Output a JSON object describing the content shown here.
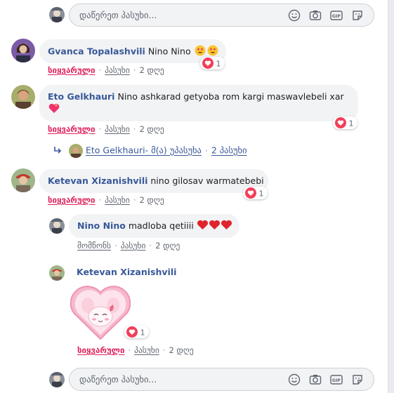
{
  "input_placeholder": "დაწერეთ პასუხი...",
  "actions": {
    "like": "სიყვარული",
    "like_plain": "მომწონს",
    "reply": "პასუხი",
    "time": "2 დღე"
  },
  "comments": [
    {
      "author": "Gvanca Topalashvili",
      "text": "Nino Nino",
      "reaction_count": "1"
    },
    {
      "author": "Eto Gelkhauri",
      "text": "Nino ashkarad getyoba rom kargi maswavlebeli xar",
      "reaction_count": "1",
      "reply_summary": {
        "author": "Eto Gelkhauri",
        "suffix": "- მ(ა) უპასუხა",
        "count": "2 პასუხი"
      }
    },
    {
      "author": "Ketevan Xizanishvili",
      "text": "nino gilosav warmatebebi",
      "reaction_count": "1",
      "replies": [
        {
          "author": "Nino Nino",
          "text": "madloba qetiiii"
        },
        {
          "author": "Ketevan Xizanishvili",
          "sticker": "heart-bunny-sticker",
          "reaction_count": "1"
        }
      ]
    }
  ],
  "colors": {
    "link": "#385898",
    "love": "#e0245e",
    "bubble": "#f2f3f5"
  }
}
